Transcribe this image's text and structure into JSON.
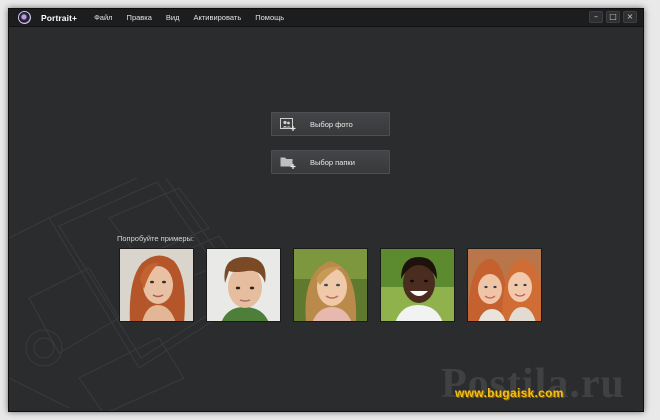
{
  "app": {
    "title": "Portrait+",
    "accent": "#f2c21a"
  },
  "menu": [
    {
      "label": "Файл"
    },
    {
      "label": "Правка"
    },
    {
      "label": "Вид"
    },
    {
      "label": "Активировать"
    },
    {
      "label": "Помощь"
    }
  ],
  "window_controls": {
    "minimize": "–",
    "maximize": "□",
    "close": "×"
  },
  "actions": {
    "select_photo": {
      "label": "Выбор фото",
      "icon": "add-photo-icon"
    },
    "select_folder": {
      "label": "Выбор папки",
      "icon": "add-folder-icon"
    }
  },
  "examples": {
    "label": "Попробуйте примеры:",
    "thumbnails": [
      {
        "name": "redhead-woman",
        "icon": "portrait-thumbnail"
      },
      {
        "name": "boy",
        "icon": "portrait-thumbnail"
      },
      {
        "name": "girl-blonde",
        "icon": "portrait-thumbnail"
      },
      {
        "name": "girl-smiling",
        "icon": "portrait-thumbnail"
      },
      {
        "name": "two-girls",
        "icon": "portrait-thumbnail"
      }
    ]
  },
  "watermark": {
    "main": "Postila.ru",
    "url": "www.bugaisk.com"
  }
}
